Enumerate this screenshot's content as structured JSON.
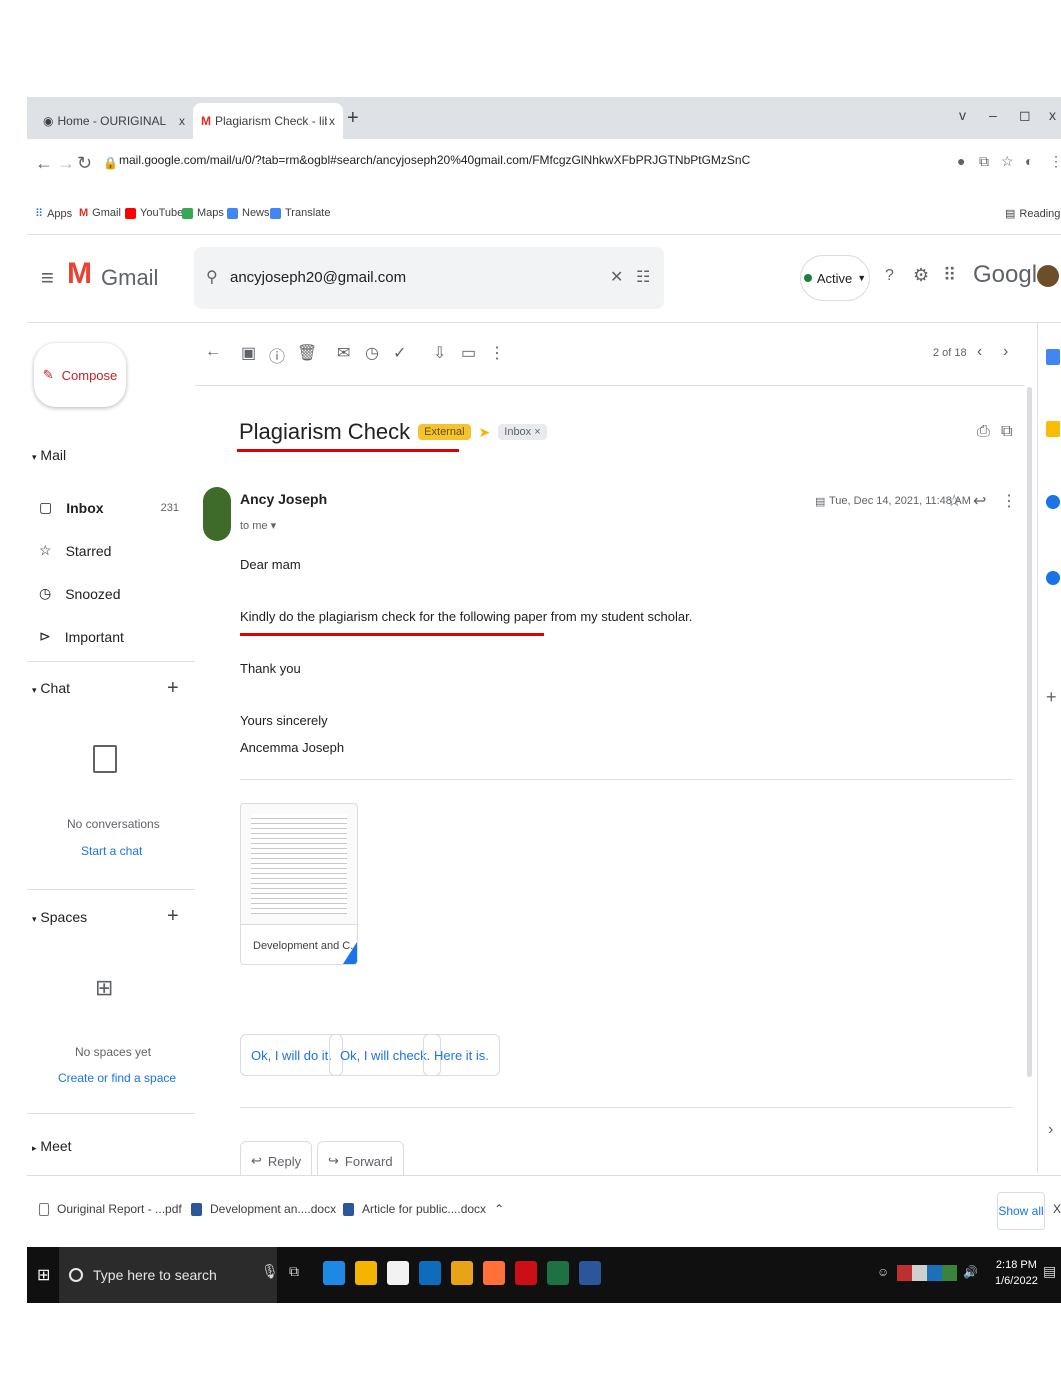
{
  "browser": {
    "tabs": [
      {
        "label": "Home - OURIGINAL",
        "close": "x"
      },
      {
        "label": "Plagiarism Check - library@fatim",
        "close": "x"
      }
    ],
    "new_tab": "+",
    "window_controls": {
      "chevron": "v",
      "minimize": "–",
      "restore": "◻",
      "close": "x"
    },
    "url": "mail.google.com/mail/u/0/?tab=rm&ogbl#search/ancyjoseph20%40gmail.com/FMfcgzGlNhkwXFbPRJGTNbPtGMzSnC",
    "bookmarks": [
      "Apps",
      "Gmail",
      "YouTube",
      "Maps",
      "News",
      "Translate"
    ],
    "reading_list": "Reading list"
  },
  "gmail": {
    "brand": "Gmail",
    "search_value": "ancyjoseph20@gmail.com",
    "status": "Active",
    "google_label": "Google"
  },
  "sidebar": {
    "compose": "Compose",
    "mail_section": "Mail",
    "items": [
      {
        "label": "Inbox",
        "count": "231"
      },
      {
        "label": "Starred",
        "count": ""
      },
      {
        "label": "Snoozed",
        "count": ""
      },
      {
        "label": "Important",
        "count": ""
      }
    ],
    "chat_section": "Chat",
    "chat_empty": "No conversations",
    "chat_link": "Start a chat",
    "spaces_section": "Spaces",
    "spaces_empty": "No spaces yet",
    "spaces_link": "Create or find a space",
    "meet_section": "Meet"
  },
  "toolbar": {
    "pagination": "2 of 18"
  },
  "email": {
    "subject": "Plagiarism Check",
    "label_external": "External",
    "label_inbox": "Inbox ×",
    "sender": "Ancy Joseph",
    "to": "to me ▾",
    "date": "Tue, Dec 14, 2021, 11:48 AM",
    "body": [
      "Dear mam",
      "Kindly do the plagiarism check for the following paper from my student scholar.",
      "Thank you",
      "Yours sincerely",
      "Ancemma Joseph"
    ],
    "attachment_name": "Development and C...",
    "smart_replies": [
      "Ok, I will do it.",
      "Ok, I will check.",
      "Here it is."
    ],
    "reply": "Reply",
    "forward": "Forward"
  },
  "downloads": {
    "items": [
      "Ouriginal Report - ...pdf",
      "Development an....docx",
      "Article for public....docx"
    ],
    "show_all": "Show all",
    "close": "X"
  },
  "taskbar": {
    "search_placeholder": "Type here to search",
    "time": "2:18 PM",
    "date": "1/6/2022"
  }
}
